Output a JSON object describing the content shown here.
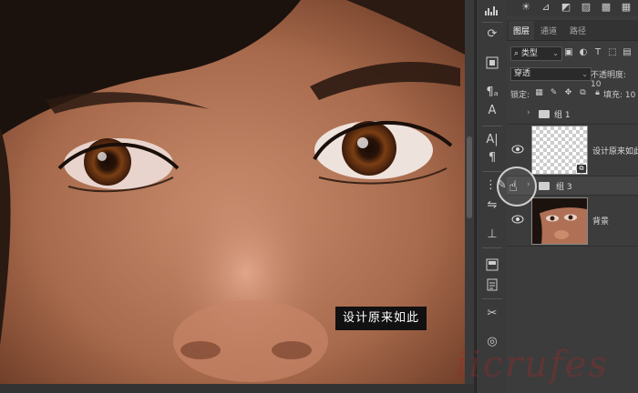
{
  "canvas": {
    "tooltip": "设计原来如此"
  },
  "toolbar": {
    "icons": [
      "histogram-icon",
      "3d-rotate-icon",
      "resize-icon",
      "text-style-icon",
      "text-icon",
      "paragraph-icon",
      "brush-settings-icon",
      "adjust-icon",
      "stamp-icon",
      "layers-icon",
      "document-icon",
      "scissors-icon",
      "navigator-icon"
    ]
  },
  "layers_panel": {
    "tabs": [
      "图层",
      "通道",
      "路径"
    ],
    "active_tab": "图层",
    "filter_kind": "类型",
    "blend_mode": "穿透",
    "opacity_label": "不透明度:",
    "opacity_value": "10",
    "lock_label": "锁定:",
    "fill_label": "填充:",
    "fill_value": "10",
    "layers": [
      {
        "name": "组 1",
        "type": "group",
        "visible": false
      },
      {
        "name": "设计原来如此",
        "type": "smart-object",
        "visible": true
      },
      {
        "name": "组 3",
        "type": "group",
        "visible": true
      },
      {
        "name": "背景",
        "type": "image",
        "visible": true
      }
    ]
  },
  "watermark": "iicrufes"
}
